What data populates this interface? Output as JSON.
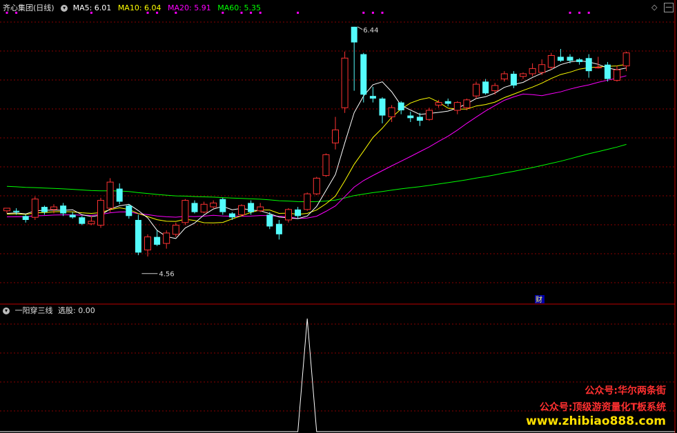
{
  "main_panel": {
    "title": "齐心集团(日线)",
    "ma": [
      {
        "label": "MA5: 6.01",
        "color": "#ffffff"
      },
      {
        "label": "MA10: 6.04",
        "color": "#ffff00"
      },
      {
        "label": "MA20: 5.91",
        "color": "#ff00ff"
      },
      {
        "label": "MA60: 5.35",
        "color": "#00ff00"
      }
    ],
    "high_label": "6.44",
    "low_label": "4.56",
    "fin_badge": "财",
    "colors": {
      "up": "#ff3232",
      "down": "#54fcfc",
      "grid": "#8b0000",
      "border": "#c00000"
    }
  },
  "sub_panel": {
    "title": "一阳穿三线",
    "value_label": "选股: 0.00",
    "line_color": "#ffffff"
  },
  "watermark": {
    "line1": "公众号:华尔两条街",
    "line2": "公众号:顶级游资量化T板系统",
    "line3": "www.zhibiao888.com",
    "color1": "#ff3030",
    "color3": "#ffe000"
  },
  "chart_data": {
    "type": "candlestick",
    "y_range": [
      4.4,
      6.55
    ],
    "candles": [
      [
        5.03,
        5.05,
        5.01,
        5.04
      ],
      [
        5.03,
        5.02,
        5.0,
        5.05
      ],
      [
        4.99,
        4.96,
        4.94,
        5.0
      ],
      [
        4.98,
        5.12,
        4.96,
        5.14
      ],
      [
        5.06,
        5.02,
        5.0,
        5.07
      ],
      [
        5.04,
        5.06,
        5.01,
        5.08
      ],
      [
        5.07,
        5.01,
        4.99,
        5.09
      ],
      [
        5.0,
        4.98,
        4.97,
        5.02
      ],
      [
        4.98,
        4.93,
        4.92,
        4.99
      ],
      [
        4.93,
        4.95,
        4.92,
        4.99
      ],
      [
        4.92,
        5.11,
        4.9,
        5.13
      ],
      [
        5.05,
        5.25,
        5.02,
        5.28
      ],
      [
        5.2,
        5.1,
        5.08,
        5.24
      ],
      [
        5.07,
        4.99,
        4.97,
        5.08
      ],
      [
        4.96,
        4.71,
        4.69,
        5.0
      ],
      [
        4.73,
        4.83,
        4.68,
        4.85
      ],
      [
        4.83,
        4.77,
        4.76,
        4.88
      ],
      [
        4.78,
        4.86,
        4.74,
        4.88
      ],
      [
        4.85,
        4.92,
        4.83,
        4.94
      ],
      [
        4.94,
        5.11,
        4.92,
        5.12
      ],
      [
        5.09,
        5.02,
        5.01,
        5.11
      ],
      [
        5.02,
        5.08,
        5.01,
        5.1
      ],
      [
        5.06,
        5.09,
        5.05,
        5.11
      ],
      [
        5.12,
        5.02,
        5.0,
        5.13
      ],
      [
        5.01,
        4.98,
        4.96,
        5.02
      ],
      [
        5.0,
        5.07,
        4.99,
        5.08
      ],
      [
        5.09,
        5.02,
        5.0,
        5.11
      ],
      [
        5.03,
        5.06,
        5.02,
        5.09
      ],
      [
        5.0,
        4.91,
        4.89,
        5.02
      ],
      [
        4.93,
        4.85,
        4.81,
        4.96
      ],
      [
        4.96,
        5.04,
        4.94,
        5.05
      ],
      [
        5.04,
        4.99,
        4.97,
        5.06
      ],
      [
        5.04,
        5.16,
        5.03,
        5.17
      ],
      [
        5.16,
        5.28,
        5.15,
        5.29
      ],
      [
        5.3,
        5.46,
        5.29,
        5.47
      ],
      [
        5.55,
        5.65,
        5.5,
        5.75
      ],
      [
        5.82,
        6.2,
        5.78,
        6.25
      ],
      [
        6.44,
        6.32,
        5.95,
        6.44
      ],
      [
        6.23,
        5.92,
        5.86,
        6.24
      ],
      [
        5.91,
        5.89,
        5.86,
        5.98
      ],
      [
        5.89,
        5.76,
        5.7,
        5.9
      ],
      [
        5.75,
        5.82,
        5.71,
        5.84
      ],
      [
        5.86,
        5.8,
        5.77,
        5.87
      ],
      [
        5.76,
        5.74,
        5.71,
        5.79
      ],
      [
        5.75,
        5.72,
        5.68,
        5.78
      ],
      [
        5.73,
        5.8,
        5.72,
        5.82
      ],
      [
        5.84,
        5.86,
        5.82,
        5.88
      ],
      [
        5.87,
        5.85,
        5.83,
        5.89
      ],
      [
        5.8,
        5.86,
        5.77,
        5.87
      ],
      [
        5.82,
        5.88,
        5.8,
        5.89
      ],
      [
        5.91,
        6.0,
        5.89,
        6.02
      ],
      [
        6.02,
        5.93,
        5.92,
        6.04
      ],
      [
        5.95,
        5.99,
        5.92,
        6.01
      ],
      [
        6.04,
        6.08,
        6.02,
        6.1
      ],
      [
        6.08,
        5.99,
        5.97,
        6.1
      ],
      [
        6.06,
        6.08,
        6.04,
        6.09
      ],
      [
        6.08,
        6.12,
        6.06,
        6.16
      ],
      [
        6.09,
        6.15,
        6.07,
        6.19
      ],
      [
        6.13,
        6.22,
        6.11,
        6.24
      ],
      [
        6.21,
        6.18,
        6.17,
        6.27
      ],
      [
        6.21,
        6.18,
        6.16,
        6.23
      ],
      [
        6.19,
        6.17,
        6.15,
        6.2
      ],
      [
        6.2,
        6.1,
        6.05,
        6.23
      ],
      [
        6.13,
        6.13,
        6.12,
        6.21
      ],
      [
        6.15,
        6.04,
        6.02,
        6.17
      ],
      [
        6.03,
        6.11,
        6.02,
        6.14
      ],
      [
        6.14,
        6.24,
        6.1,
        6.25
      ]
    ],
    "ma_end_values": {
      "MA5": 6.01,
      "MA10": 6.04,
      "MA20": 5.91,
      "MA60": 5.35
    },
    "signal": {
      "series": "选股",
      "values": [
        0,
        0,
        0,
        0,
        0,
        0,
        0,
        0,
        0,
        0,
        0,
        0,
        0,
        0,
        0,
        0,
        0,
        0,
        0,
        0,
        0,
        0,
        0,
        0,
        0,
        0,
        0,
        0,
        0,
        0,
        0,
        0,
        1,
        0,
        0,
        0,
        0,
        0,
        0,
        0,
        0,
        0,
        0,
        0,
        0,
        0,
        0,
        0,
        0,
        0,
        0,
        0,
        0,
        0,
        0,
        0,
        0,
        0,
        0,
        0,
        0,
        0,
        0,
        0,
        0,
        0,
        0
      ]
    },
    "marker_cols": [
      0,
      1,
      9,
      15,
      16,
      18,
      23,
      25,
      26,
      27,
      31,
      38,
      39,
      40,
      60,
      61,
      62
    ]
  }
}
